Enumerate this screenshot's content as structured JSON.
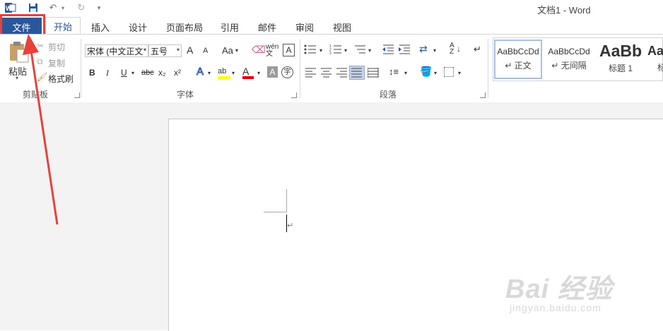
{
  "titlebar": {
    "title": "文档1 - Word",
    "app_icon": "word-icon",
    "save_icon": "save-icon",
    "undo_icon": "undo-icon",
    "redo_icon": "redo-icon",
    "customize_icon": "customize-qat-icon"
  },
  "tabs": {
    "file": "文件",
    "home": "开始",
    "items": [
      "插入",
      "设计",
      "页面布局",
      "引用",
      "邮件",
      "审阅",
      "视图"
    ]
  },
  "clipboard": {
    "paste": "粘贴",
    "cut": "剪切",
    "copy": "复制",
    "format_painter": "格式刷",
    "group_label": "剪贴板"
  },
  "font": {
    "font_name": "宋体 (中文正文",
    "font_size": "五号",
    "grow": "A",
    "shrink": "A",
    "change_case": "Aa",
    "phonetic": "wén文",
    "bold": "B",
    "italic": "I",
    "underline": "U",
    "strike": "abc",
    "subscript": "x₂",
    "superscript": "x²",
    "text_effects": "A",
    "highlight": "ab",
    "font_color": "A",
    "char_shading": "A",
    "enclose": "字",
    "group_label": "字体"
  },
  "paragraph": {
    "group_label": "段落"
  },
  "styles": {
    "items": [
      {
        "sample": "AaBbCcDd",
        "name": "↵ 正文"
      },
      {
        "sample": "AaBbCcDd",
        "name": "↵ 无间隔"
      },
      {
        "sample": "AaBb",
        "name": "标题 1"
      },
      {
        "sample": "Aa",
        "name": "标"
      }
    ]
  },
  "colors": {
    "accent": "#2b579a",
    "annotation": "#e8413c",
    "highlight": "#ffff00",
    "font_red": "#e00000"
  },
  "document": {
    "paragraph_mark": "↵"
  },
  "watermark": {
    "brand": "Bai 经验",
    "url": "jingyan.baidu.com"
  }
}
